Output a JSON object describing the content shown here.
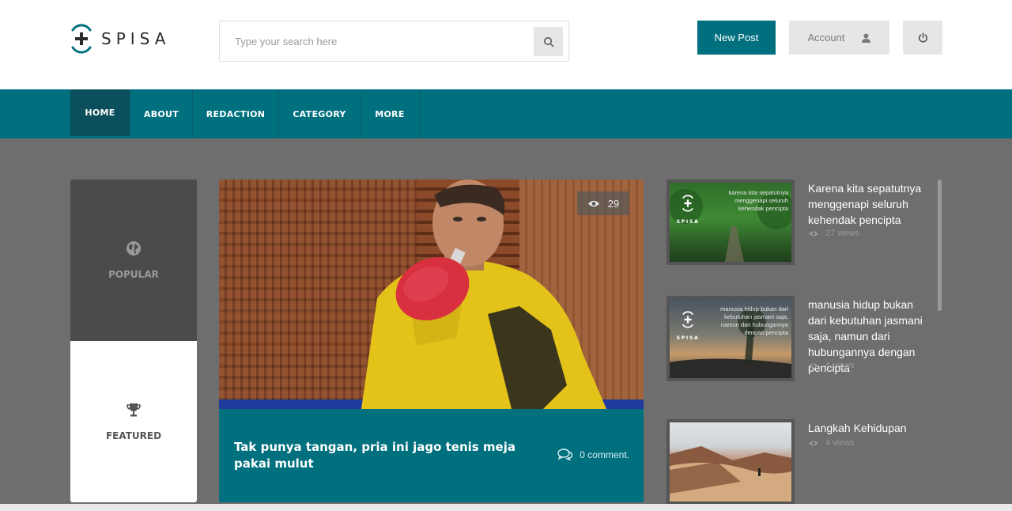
{
  "brand": {
    "name": "SPISA"
  },
  "search": {
    "placeholder": "Type your search here"
  },
  "header": {
    "new_post_label": "New Post",
    "account_label": "Account"
  },
  "nav": {
    "items": [
      "HOME",
      "ABOUT",
      "REDACTION",
      "CATEGORY",
      "MORE"
    ],
    "active": "HOME"
  },
  "tabs": {
    "popular_label": "POPULAR",
    "featured_label": "FEATURED"
  },
  "featured_post": {
    "title": "Tak punya tangan, pria ini jago tenis meja pakai mulut",
    "views": "29",
    "comments": "0 comment."
  },
  "side_posts": [
    {
      "title": "Karena kita sepatutnya menggenapi seluruh kehendak pencipta",
      "views": "27 views",
      "thumb_quote": "karena kita sepatutnya menggenapi seluruh kehendak pencipta",
      "thumb_brand": "SPISA"
    },
    {
      "title": "manusia hidup bukan dari kebutuhan jasmani saja, namun dari hubungannya dengan pencipta",
      "views": "4 views",
      "thumb_quote": "manusia hidup bukan dari kebutuhan jasmani saja, namun dari hubungannya dengan pencipta",
      "thumb_brand": "SPISA"
    },
    {
      "title": "Langkah Kehidupan",
      "views": "4 views"
    }
  ],
  "colors": {
    "teal": "#00707f",
    "teal_dark": "#0b4f5c",
    "background": "#6e6e6e",
    "tab_dark": "#4b4b4b"
  },
  "icons": {
    "search": "search-icon",
    "account": "user-icon",
    "power": "power-icon",
    "popular": "globe-icon",
    "featured": "trophy-icon",
    "views": "eye-icon",
    "comments": "comments-icon"
  }
}
